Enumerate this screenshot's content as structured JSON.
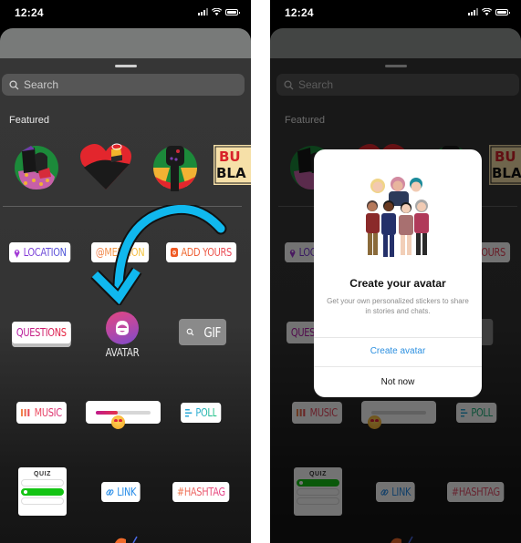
{
  "status_bar": {
    "time": "12:24"
  },
  "sheet": {
    "search_placeholder": "Search",
    "featured_label": "Featured",
    "featured_stickers": [
      "unity-couple-sticker",
      "heart-afro-pick-sticker",
      "raised-fist-sticker",
      "buy-black-sticker"
    ],
    "featured_partial_text": "BU BLAC",
    "stickers": {
      "location": "LOCATION",
      "mention": "@MENTION",
      "add_yours": "ADD YOURS",
      "questions": "QUESTIONS",
      "avatar": "AVATAR",
      "gif": "GIF",
      "music": "MUSIC",
      "emoji_slider_value": 0.4,
      "poll": "POLL",
      "quiz": "QUIZ",
      "link": "LINK",
      "hashtag": "#HASHTAG"
    }
  },
  "modal": {
    "title": "Create your avatar",
    "description": "Get your own personalized stickers to share in stories and chats.",
    "primary_button": "Create avatar",
    "secondary_button": "Not now"
  },
  "colors": {
    "accent_blue": "#2b8fe0",
    "arrow_blue": "#10b8ee",
    "quiz_green": "#14c414",
    "sheet_bg": "#363636"
  }
}
